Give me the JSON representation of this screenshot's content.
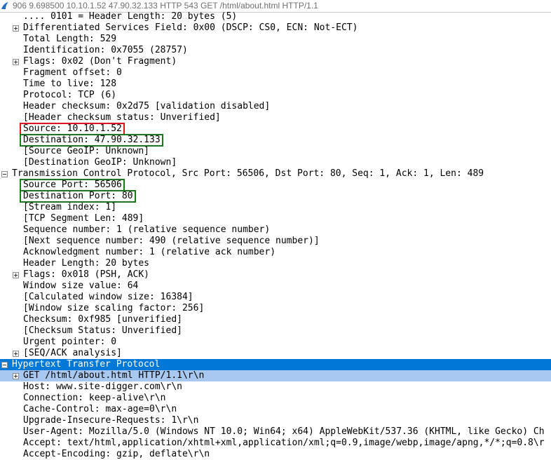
{
  "title_bar": {
    "text": "906 9.698500 10.10.1.52 47.90.32.133 HTTP 543 GET /html/about.html HTTP/1.1",
    "icon": "shark-fin-icon"
  },
  "rows": [
    {
      "text": ".... 0101 = Header Length: 20 bytes (5)",
      "indent": 1,
      "expander": "none"
    },
    {
      "text": "Differentiated Services Field: 0x00 (DSCP: CS0, ECN: Not-ECT)",
      "indent": 1,
      "expander": "plus"
    },
    {
      "text": "Total Length: 529",
      "indent": 1,
      "expander": "none"
    },
    {
      "text": "Identification: 0x7055 (28757)",
      "indent": 1,
      "expander": "none"
    },
    {
      "text": "Flags: 0x02 (Don't Fragment)",
      "indent": 1,
      "expander": "plus"
    },
    {
      "text": "Fragment offset: 0",
      "indent": 1,
      "expander": "none"
    },
    {
      "text": "Time to live: 128",
      "indent": 1,
      "expander": "none"
    },
    {
      "text": "Protocol: TCP (6)",
      "indent": 1,
      "expander": "none"
    },
    {
      "text": "Header checksum: 0x2d75 [validation disabled]",
      "indent": 1,
      "expander": "none"
    },
    {
      "text": "[Header checksum status: Unverified]",
      "indent": 1,
      "expander": "none"
    },
    {
      "text": "Source: 10.10.1.52",
      "indent": 1,
      "expander": "none",
      "box": "red"
    },
    {
      "text": "Destination: 47.90.32.133",
      "indent": 1,
      "expander": "none",
      "box": "green"
    },
    {
      "text": "[Source GeoIP: Unknown]",
      "indent": 1,
      "expander": "none"
    },
    {
      "text": "[Destination GeoIP: Unknown]",
      "indent": 1,
      "expander": "none"
    },
    {
      "text": "Transmission Control Protocol, Src Port: 56506, Dst Port: 80, Seq: 1, Ack: 1, Len: 489",
      "indent": 0,
      "expander": "minus"
    },
    {
      "text": "Source Port: 56506",
      "indent": 1,
      "expander": "none",
      "box": "green"
    },
    {
      "text": "Destination Port: 80",
      "indent": 1,
      "expander": "none",
      "box": "green"
    },
    {
      "text": "[Stream index: 1]",
      "indent": 1,
      "expander": "none"
    },
    {
      "text": "[TCP Segment Len: 489]",
      "indent": 1,
      "expander": "none"
    },
    {
      "text": "Sequence number: 1    (relative sequence number)",
      "indent": 1,
      "expander": "none"
    },
    {
      "text": "[Next sequence number: 490    (relative sequence number)]",
      "indent": 1,
      "expander": "none"
    },
    {
      "text": "Acknowledgment number: 1    (relative ack number)",
      "indent": 1,
      "expander": "none"
    },
    {
      "text": "Header Length: 20 bytes",
      "indent": 1,
      "expander": "none"
    },
    {
      "text": "Flags: 0x018 (PSH, ACK)",
      "indent": 1,
      "expander": "plus"
    },
    {
      "text": "Window size value: 64",
      "indent": 1,
      "expander": "none"
    },
    {
      "text": "[Calculated window size: 16384]",
      "indent": 1,
      "expander": "none"
    },
    {
      "text": "[Window size scaling factor: 256]",
      "indent": 1,
      "expander": "none"
    },
    {
      "text": "Checksum: 0xf985 [unverified]",
      "indent": 1,
      "expander": "none"
    },
    {
      "text": "[Checksum Status: Unverified]",
      "indent": 1,
      "expander": "none"
    },
    {
      "text": "Urgent pointer: 0",
      "indent": 1,
      "expander": "none"
    },
    {
      "text": "[SEQ/ACK analysis]",
      "indent": 1,
      "expander": "plus"
    },
    {
      "text": "Hypertext Transfer Protocol",
      "indent": 0,
      "expander": "minus",
      "state": "selected"
    },
    {
      "text": "GET /html/about.html HTTP/1.1\\r\\n",
      "indent": 1,
      "expander": "plus",
      "state": "highlight"
    },
    {
      "text": "Host: www.site-digger.com\\r\\n",
      "indent": 1,
      "expander": "none"
    },
    {
      "text": "Connection: keep-alive\\r\\n",
      "indent": 1,
      "expander": "none"
    },
    {
      "text": "Cache-Control: max-age=0\\r\\n",
      "indent": 1,
      "expander": "none"
    },
    {
      "text": "Upgrade-Insecure-Requests: 1\\r\\n",
      "indent": 1,
      "expander": "none"
    },
    {
      "text": "User-Agent: Mozilla/5.0 (Windows NT 10.0; Win64; x64) AppleWebKit/537.36 (KHTML, like Gecko) Ch",
      "indent": 1,
      "expander": "none"
    },
    {
      "text": "Accept: text/html,application/xhtml+xml,application/xml;q=0.9,image/webp,image/apng,*/*;q=0.8\\r",
      "indent": 1,
      "expander": "none"
    },
    {
      "text": "Accept-Encoding: gzip, deflate\\r\\n",
      "indent": 1,
      "expander": "none"
    }
  ],
  "colors": {
    "selected_bg": "#0078d7",
    "highlight_bg": "#a8c8f0",
    "box_red": "#e0141e",
    "box_green": "#1a7a1a"
  }
}
